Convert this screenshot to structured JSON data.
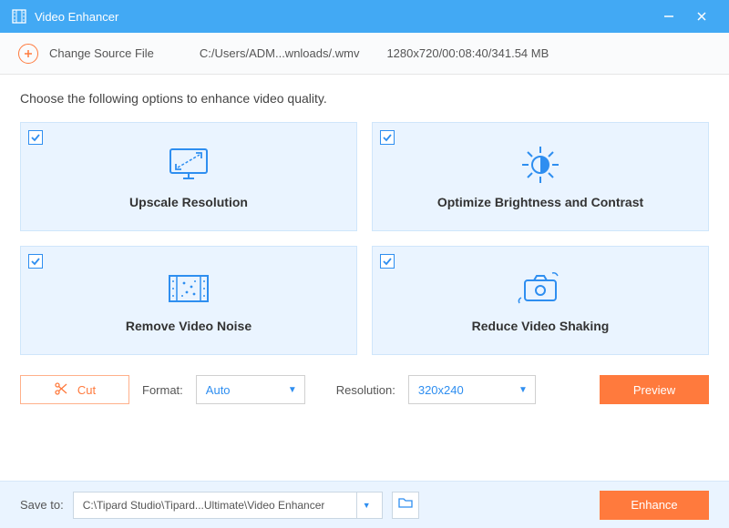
{
  "titlebar": {
    "app_name": "Video Enhancer"
  },
  "sourcebar": {
    "change_label": "Change Source File",
    "file_path": "C:/Users/ADM...wnloads/.wmv",
    "file_info": "1280x720/00:08:40/341.54 MB"
  },
  "instruction": "Choose the following options to enhance video quality.",
  "options": [
    {
      "label": "Upscale Resolution"
    },
    {
      "label": "Optimize Brightness and Contrast"
    },
    {
      "label": "Remove Video Noise"
    },
    {
      "label": "Reduce Video Shaking"
    }
  ],
  "controls": {
    "cut_label": "Cut",
    "format_label": "Format:",
    "format_value": "Auto",
    "resolution_label": "Resolution:",
    "resolution_value": "320x240",
    "preview_label": "Preview"
  },
  "bottombar": {
    "save_to_label": "Save to:",
    "save_path": "C:\\Tipard Studio\\Tipard...Ultimate\\Video Enhancer",
    "enhance_label": "Enhance"
  },
  "colors": {
    "accent_blue": "#42a9f4",
    "accent_orange": "#ff7a3d"
  }
}
